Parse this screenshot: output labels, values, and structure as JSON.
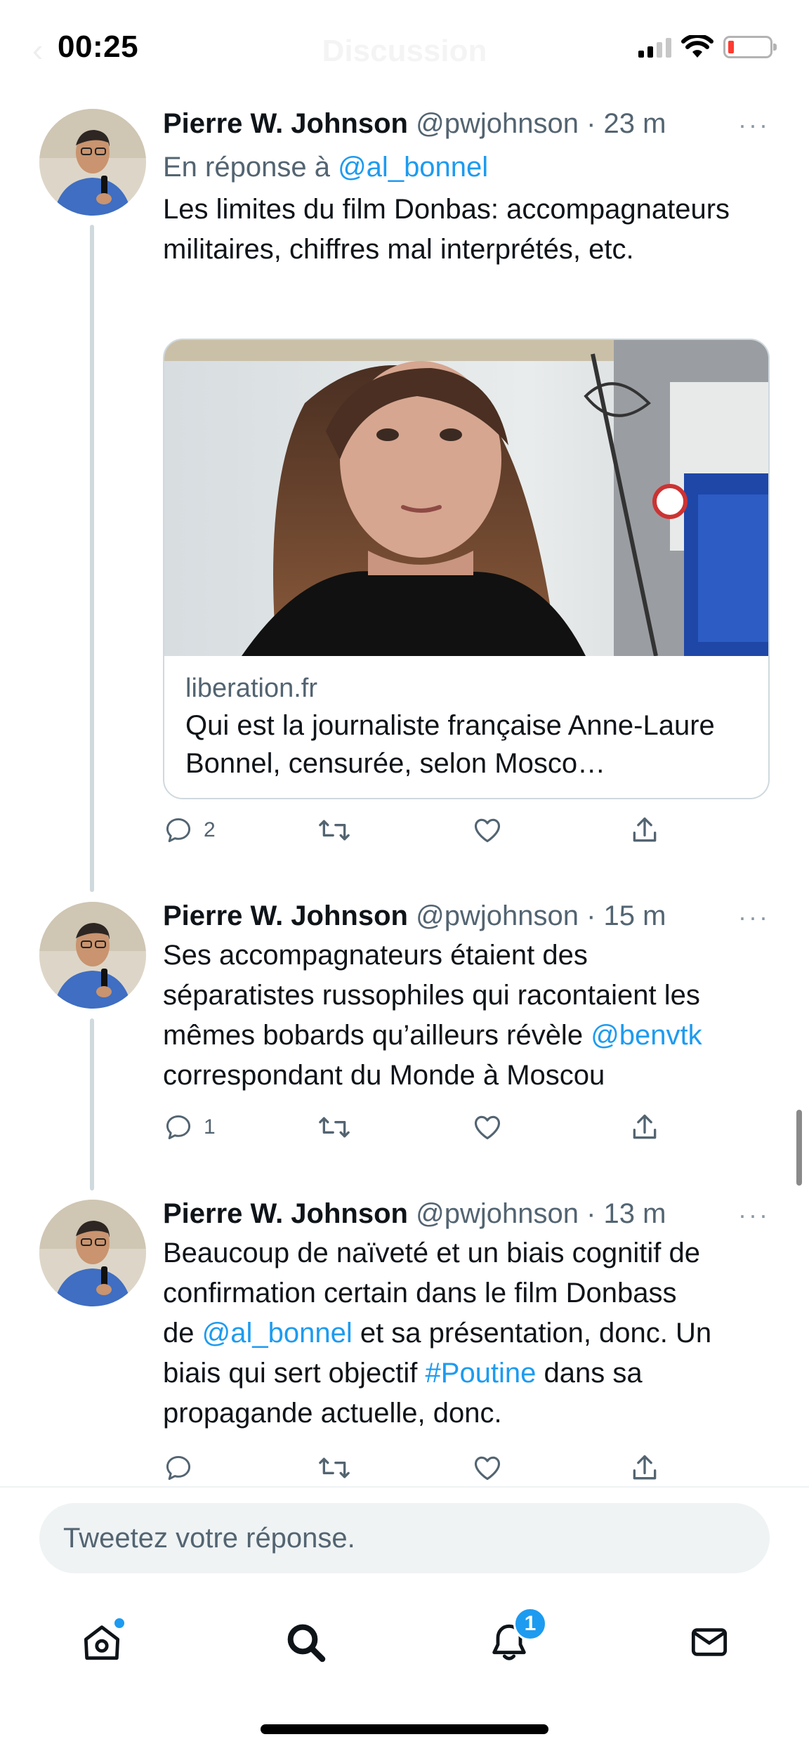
{
  "status_bar": {
    "time": "00:25",
    "screen_title": "Discussion",
    "icons": [
      "back-chevron-icon",
      "signal-icon",
      "wifi-icon",
      "battery-icon"
    ]
  },
  "tweets": [
    {
      "name": "Pierre W. Johnson",
      "handle": "@pwjohnson",
      "separator": "·",
      "time": "23 m",
      "more": "···",
      "reply_prefix": "En réponse à",
      "reply_to": "@al_bonnel",
      "text": "Les limites du film Donbas: accompagnateurs militaires, chiffres mal interprétés, etc.",
      "card": {
        "domain": "liberation.fr",
        "title": "Qui est la journaliste française Anne-Laure Bonnel, censurée, selon Mosco…"
      },
      "replies": "2",
      "retweets": "",
      "likes": ""
    },
    {
      "name": "Pierre W. Johnson",
      "handle": "@pwjohnson",
      "separator": "·",
      "time": "15 m",
      "more": "···",
      "text_line1": "Ses accompagnateurs étaient des",
      "text_line2": "séparatistes russophiles qui racontaient les",
      "text_line3a": "mêmes bobards qu’ailleurs révèle ",
      "mention": "@benvtk",
      "text_line4": "correspondant du Monde à Moscou",
      "replies": "1"
    },
    {
      "name": "Pierre W. Johnson",
      "handle": "@pwjohnson",
      "separator": "·",
      "time": "13 m",
      "more": "···",
      "text_line1": "Beaucoup de naïveté et un biais cognitif de",
      "text_line2": "confirmation certain dans le film Donbass",
      "text_line3a": "de ",
      "mention": "@al_bonnel",
      "text_line3b": " et sa présentation, donc. Un",
      "text_line4a": "biais qui sert objectif ",
      "hashtag": "#Poutine",
      "text_line4b": " dans sa",
      "text_line5": "propagande actuelle, donc."
    }
  ],
  "compose": {
    "placeholder": "Tweetez votre réponse."
  },
  "tab_bar": {
    "tabs": [
      "home-icon",
      "search-icon",
      "notifications-icon",
      "messages-icon"
    ],
    "notification_count": "1"
  },
  "colors": {
    "link": "#1d9bf0",
    "text": "#0f1419",
    "secondary": "#536471",
    "border": "#cfd9de"
  }
}
